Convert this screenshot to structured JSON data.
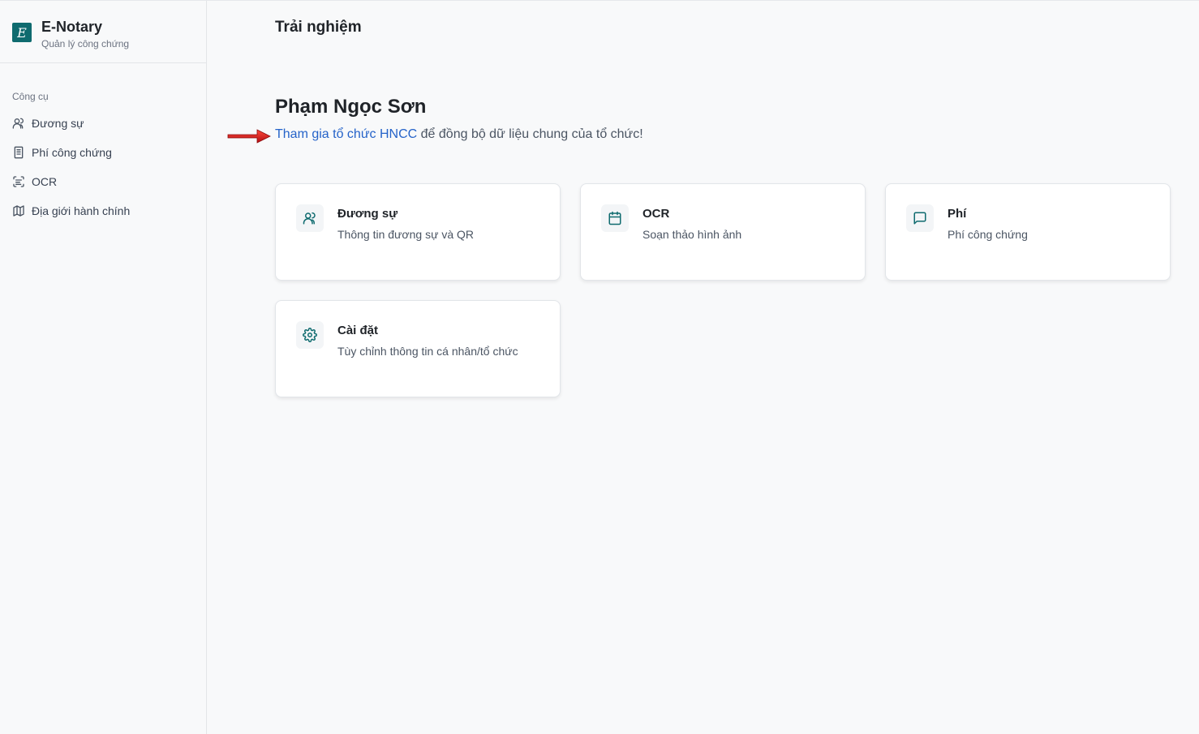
{
  "brand": {
    "logo_letter": "E",
    "title": "E-Notary",
    "subtitle": "Quản lý công chứng"
  },
  "sidebar": {
    "section_label": "Công cụ",
    "items": [
      {
        "label": "Đương sự",
        "icon": "users-icon"
      },
      {
        "label": "Phí công chứng",
        "icon": "document-icon"
      },
      {
        "label": "OCR",
        "icon": "scan-text-icon"
      },
      {
        "label": "Địa giới hành chính",
        "icon": "map-icon"
      }
    ]
  },
  "main": {
    "page_title": "Trải nghiệm",
    "user_name": "Phạm Ngọc Sơn",
    "join_link": "Tham gia tổ chức HNCC",
    "join_suffix": "để đồng bộ dữ liệu chung của tổ chức!",
    "cards": [
      {
        "title": "Đương sự",
        "desc": "Thông tin đương sự và QR",
        "icon": "users-icon"
      },
      {
        "title": "OCR",
        "desc": "Soạn thảo hình ảnh",
        "icon": "calendar-icon"
      },
      {
        "title": "Phí",
        "desc": "Phí công chứng",
        "icon": "message-square-icon"
      },
      {
        "title": "Cài đặt",
        "desc": "Tùy chỉnh thông tin cá nhân/tổ chức",
        "icon": "settings-gear-icon"
      }
    ]
  },
  "colors": {
    "accent": "#0f6b6f",
    "link": "#2563c9",
    "arrow": "#d7191c"
  }
}
